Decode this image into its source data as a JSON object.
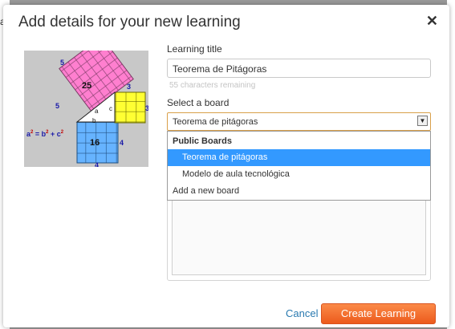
{
  "background": {
    "left_fragment": "a"
  },
  "dialog": {
    "title": "Add details for your new learning",
    "close_glyph": "✕"
  },
  "thumbnail": {
    "square_top_value": "25",
    "square_top_side_left": "5",
    "square_top_side_top": "5",
    "square_right_value": "",
    "square_right_side_top": "3",
    "square_right_side_right": "3",
    "square_bottom_value": "16",
    "square_bottom_side_right": "4",
    "square_bottom_side_bottom": "4",
    "tri_a": "a",
    "tri_b": "b",
    "tri_c": "c",
    "formula_a": "a",
    "formula_eq": " = b",
    "formula_plus": " + c",
    "formula_exp": "2"
  },
  "form": {
    "title_label": "Learning title",
    "title_value": "Teorema de Pitágoras",
    "chars_remaining": "55 characters remaining",
    "board_label": "Select a board",
    "board_selected": "Teorema de pitágoras"
  },
  "dropdown": {
    "group_label": "Public Boards",
    "items": [
      {
        "label": "Teorema de pitágoras",
        "selected": true
      },
      {
        "label": "Modelo de aula tecnológica",
        "selected": false
      }
    ],
    "add_new": "Add a new board"
  },
  "footer": {
    "cancel_label": "Cancel",
    "create_label": "Create Learning"
  },
  "colors": {
    "accent_orange": "#ec5a1c",
    "select_highlight": "#3399ff",
    "link_blue": "#2a7ab0",
    "square_pink": "#ff7fcf",
    "square_yellow": "#ffff33",
    "square_blue": "#66b3ff"
  }
}
